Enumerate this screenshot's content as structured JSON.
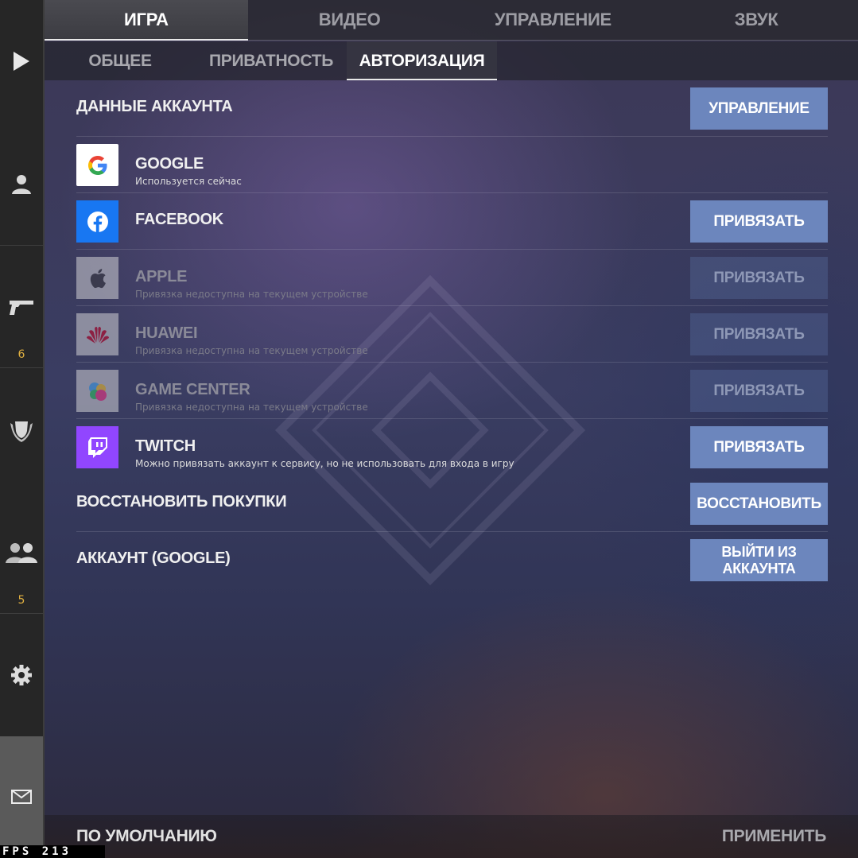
{
  "sidebar": {
    "items": [
      {
        "name": "play",
        "icon": "play-icon"
      },
      {
        "name": "profile",
        "icon": "user-icon"
      },
      {
        "name": "weapons",
        "icon": "pistol-icon",
        "count": "6"
      },
      {
        "name": "clan",
        "icon": "shield-icon"
      },
      {
        "name": "friends",
        "icon": "friends-icon",
        "count": "5"
      },
      {
        "name": "settings",
        "icon": "gear-icon"
      },
      {
        "name": "mail",
        "icon": "mail-icon"
      }
    ]
  },
  "tabs": [
    "ИГРА",
    "ВИДЕО",
    "УПРАВЛЕНИЕ",
    "ЗВУК"
  ],
  "active_tab": 0,
  "subtabs": [
    "ОБЩЕЕ",
    "ПРИВАТНОСТЬ",
    "АВТОРИЗАЦИЯ"
  ],
  "active_subtab": 2,
  "account": {
    "header_label": "ДАННЫЕ АККАУНТА",
    "manage_button": "УПРАВЛЕНИЕ",
    "services": [
      {
        "name": "GOOGLE",
        "sub": "Используется сейчас",
        "icon": "google-icon",
        "button": "",
        "enabled": true
      },
      {
        "name": "FACEBOOK",
        "sub": "",
        "icon": "facebook-icon",
        "button": "ПРИВЯЗАТЬ",
        "enabled": true
      },
      {
        "name": "APPLE",
        "sub": "Привязка недоступна на текущем устройстве",
        "icon": "apple-icon",
        "button": "ПРИВЯЗАТЬ",
        "enabled": false
      },
      {
        "name": "HUAWEI",
        "sub": "Привязка недоступна на текущем устройстве",
        "icon": "huawei-icon",
        "button": "ПРИВЯЗАТЬ",
        "enabled": false
      },
      {
        "name": "GAME CENTER",
        "sub": "Привязка недоступна на текущем устройстве",
        "icon": "game-center-icon",
        "button": "ПРИВЯЗАТЬ",
        "enabled": false
      },
      {
        "name": "TWITCH",
        "sub": "Можно привязать аккаунт к сервису, но не использовать для входа в игру",
        "icon": "twitch-icon",
        "button": "ПРИВЯЗАТЬ",
        "enabled": true
      }
    ],
    "restore_label": "ВОССТАНОВИТЬ ПОКУПКИ",
    "restore_button": "ВОССТАНОВИТЬ",
    "current_label": "АККАУНТ (GOOGLE)",
    "logout_button": "ВЫЙТИ ИЗ АККАУНТА"
  },
  "footer": {
    "defaults": "ПО УМОЛЧАНИЮ",
    "apply": "ПРИМЕНИТЬ"
  },
  "fps": "FPS 213",
  "colors": {
    "button": "#6c86bd",
    "facebook": "#1877f2",
    "twitch": "#9146ff",
    "sidebar_count": "#e0b040"
  }
}
